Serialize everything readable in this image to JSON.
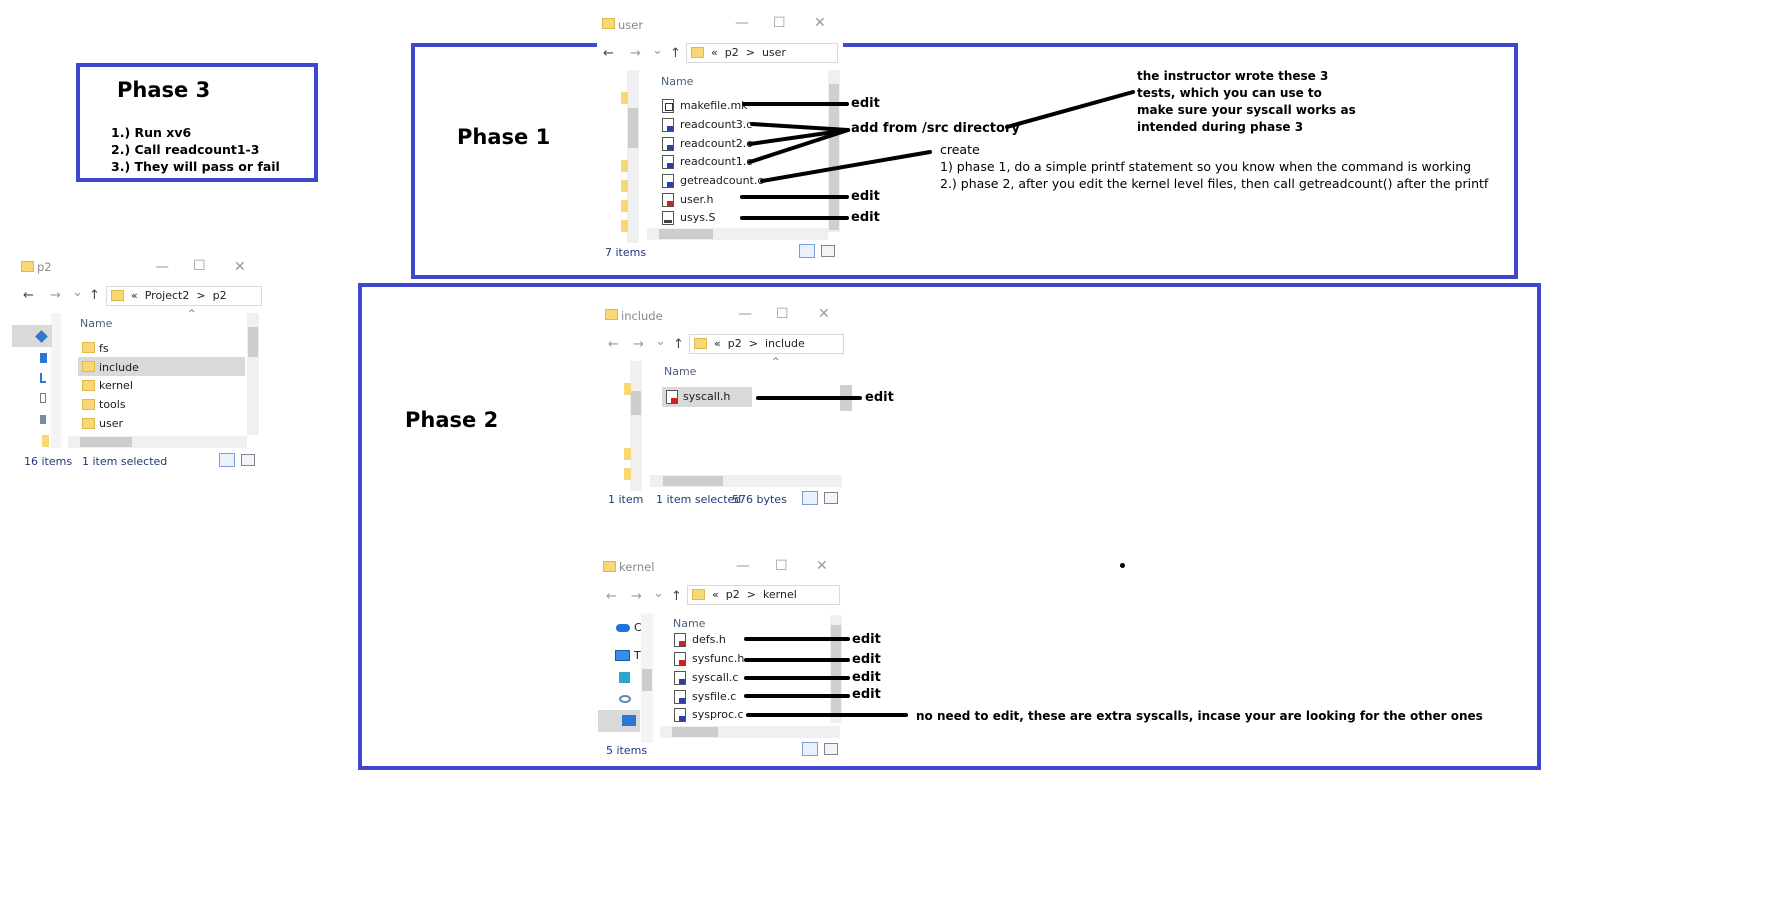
{
  "phases": {
    "phase3": {
      "title": "Phase 3",
      "steps": [
        "1.) Run xv6",
        "2.) Call readcount1-3",
        "3.) They will pass or fail"
      ]
    },
    "phase1": {
      "title": "Phase 1"
    },
    "phase2": {
      "title": "Phase 2"
    }
  },
  "annotations": {
    "edit": "edit",
    "add_from_src": "add from /src directory",
    "instructor_note": [
      "the instructor wrote these 3",
      "tests, which you can use to",
      "make sure your syscall works as",
      "intended during phase 3"
    ],
    "create": "create",
    "create_steps": [
      "1) phase 1, do a simple printf statement so you know when the command is working",
      "2.) phase 2, after you edit the kernel level files, then call getreadcount() after the printf"
    ],
    "sysproc_note": "no need to edit, these are extra syscalls, incase your are looking for the other ones"
  },
  "windows": {
    "p2": {
      "title": "p2",
      "breadcrumb": [
        "«",
        "Project2",
        ">",
        "p2"
      ],
      "column_header": "Name",
      "items": [
        "fs",
        "include",
        "kernel",
        "tools",
        "user"
      ],
      "selected_item": "include",
      "status_count": "16 items",
      "status_selected": "1 item selected"
    },
    "user": {
      "title": "user",
      "breadcrumb": [
        "«",
        "p2",
        ">",
        "user"
      ],
      "column_header": "Name",
      "items": [
        "makefile.mk",
        "readcount3.c",
        "readcount2.c",
        "readcount1.c",
        "getreadcount.c",
        "user.h",
        "usys.S"
      ],
      "status_count": "7 items"
    },
    "include": {
      "title": "include",
      "breadcrumb": [
        "«",
        "p2",
        ">",
        "include"
      ],
      "column_header": "Name",
      "items": [
        "syscall.h"
      ],
      "status_count": "1 item",
      "status_selected": "1 item selected",
      "status_size": "576 bytes"
    },
    "kernel": {
      "title": "kernel",
      "breadcrumb": [
        "«",
        "p2",
        ">",
        "kernel"
      ],
      "column_header": "Name",
      "items": [
        "defs.h",
        "sysfunc.h",
        "syscall.c",
        "sysfile.c",
        "sysproc.c"
      ],
      "nav_letters": [
        "C",
        "T"
      ],
      "status_count": "5 items"
    }
  },
  "colors": {
    "box_border": "#3f48cc",
    "folder": "#f8d775",
    "status_text": "#1e3a78"
  },
  "icons": {
    "minimize": "—",
    "maximize": "☐",
    "close": "✕",
    "back": "←",
    "forward": "→",
    "up": "↑",
    "chevron": "⌄"
  }
}
